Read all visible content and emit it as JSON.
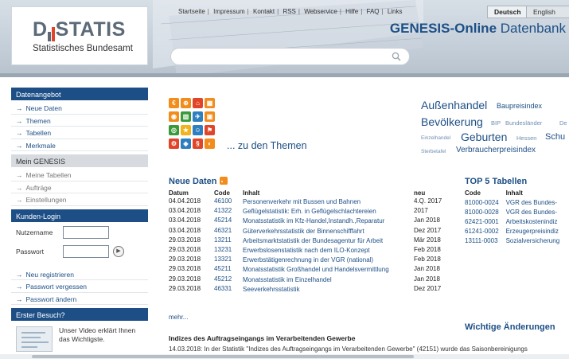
{
  "brand": {
    "logo_text": "STATIS",
    "logo_prefix": "D",
    "subtitle": "Statistisches Bundesamt",
    "colors": {
      "primary": "#1d4f86",
      "orange": "#f28c1c"
    }
  },
  "topnav": {
    "links": [
      "Startseite",
      "Impressum",
      "Kontakt",
      "RSS",
      "Webservice",
      "Hilfe",
      "FAQ",
      "Links"
    ],
    "lang_de": "Deutsch",
    "lang_en": "English"
  },
  "app_title": {
    "bold": "GENESIS-Online",
    "light": "Datenbank"
  },
  "search": {
    "placeholder": "",
    "icon": "search-icon"
  },
  "sidebar": {
    "datenangebot": {
      "title": "Datenangebot",
      "items": [
        "Neue Daten",
        "Themen",
        "Tabellen",
        "Merkmale"
      ]
    },
    "mein_genesis": {
      "title": "Mein GENESIS",
      "items": [
        "Meine Tabellen",
        "Aufträge",
        "Einstellungen"
      ]
    },
    "login": {
      "title": "Kunden-Login",
      "user_label": "Nutzername",
      "pass_label": "Passwort",
      "go_icon": "arrow-right-circle-icon"
    },
    "account_links": [
      "Neu registrieren",
      "Passwort vergessen",
      "Passwort ändern"
    ],
    "first_visit": {
      "title": "Erster Besuch?",
      "text": "Unser Video erklärt Ihnen das Wichtigste."
    }
  },
  "themes": {
    "link_text": "... zu den Themen",
    "icons": [
      {
        "name": "theme-icon-1",
        "color": "#f28c1c"
      },
      {
        "name": "theme-icon-2",
        "color": "#f28c1c"
      },
      {
        "name": "theme-icon-3",
        "color": "#e0452a"
      },
      {
        "name": "theme-icon-4",
        "color": "#f28c1c"
      },
      {
        "name": "theme-icon-5",
        "color": "#f28c1c"
      },
      {
        "name": "theme-icon-6",
        "color": "#3a9a3a"
      },
      {
        "name": "theme-icon-7",
        "color": "#2e7fc0"
      },
      {
        "name": "theme-icon-8",
        "color": "#f28c1c"
      },
      {
        "name": "theme-icon-9",
        "color": "#3a9a3a"
      },
      {
        "name": "theme-icon-10",
        "color": "#f2b41c"
      },
      {
        "name": "theme-icon-11",
        "color": "#2e7fc0"
      },
      {
        "name": "theme-icon-12",
        "color": "#e0452a"
      },
      {
        "name": "theme-icon-13",
        "color": "#e0452a"
      },
      {
        "name": "theme-icon-14",
        "color": "#2e7fc0"
      },
      {
        "name": "theme-icon-15",
        "color": "#e0452a"
      },
      {
        "name": "theme-icon-16",
        "color": "#f28c1c"
      }
    ]
  },
  "tag_cloud": [
    "Außenhandel",
    "Baupreisindex",
    "Bevölkerung",
    "BIP",
    "Bundesländer",
    "De",
    "Einzelhandel",
    "Geburten",
    "Hessen",
    "Schu",
    "Sterbetafel",
    "Verbraucherpreisindex"
  ],
  "neue_daten": {
    "title": "Neue Daten",
    "columns": [
      "Datum",
      "Code",
      "Inhalt",
      "neu"
    ],
    "rows": [
      [
        "04.04.2018",
        "46100",
        "Personenverkehr mit Bussen und Bahnen",
        "4.Q. 2017"
      ],
      [
        "03.04.2018",
        "41322",
        "Geflügelstatistik: Erh. in Geflügelschlachtereien",
        "2017"
      ],
      [
        "03.04.2018",
        "45214",
        "Monatsstatistik im Kfz-Handel,Instandh.,Reparatur",
        "Jan 2018"
      ],
      [
        "03.04.2018",
        "46321",
        "Güterverkehrsstatistik der Binnenschifffahrt",
        "Dez 2017"
      ],
      [
        "29.03.2018",
        "13211",
        "Arbeitsmarktstatistik der Bundesagentur für Arbeit",
        "Mär 2018"
      ],
      [
        "29.03.2018",
        "13231",
        "Erwerbslosenstatistik nach dem ILO-Konzept",
        "Feb 2018"
      ],
      [
        "29.03.2018",
        "13321",
        "Erwerbstätigenrechnung in der VGR (national)",
        "Feb 2018"
      ],
      [
        "29.03.2018",
        "45211",
        "Monatsstatistik Großhandel und Handelsvermittlung",
        "Jan 2018"
      ],
      [
        "29.03.2018",
        "45212",
        "Monatsstatistik im Einzelhandel",
        "Jan 2018"
      ],
      [
        "29.03.2018",
        "46331",
        "Seeverkehrsstatistik",
        "Dez 2017"
      ]
    ],
    "more": "mehr..."
  },
  "top5": {
    "title": "TOP 5 Tabellen",
    "columns": [
      "Code",
      "Inhalt"
    ],
    "rows": [
      [
        "81000-0024",
        "VGR des Bundes-"
      ],
      [
        "81000-0028",
        "VGR des Bundes-"
      ],
      [
        "62421-0001",
        "Arbeitskostenindiz"
      ],
      [
        "61241-0002",
        "Erzeugerpreisindiz"
      ],
      [
        "13111-0003",
        "Sozialversicherung"
      ]
    ]
  },
  "wichtige": {
    "title": "Wichtige Änderungen"
  },
  "news": {
    "title": "Indizes des Auftragseingangs im Verarbeitenden Gewerbe",
    "text": "14.03.2018: In der Statistik \"Indizes des Auftragseingangs im Verarbeitenden Gewerbe\" (42151) wurde das Saisonbereinigungs"
  }
}
